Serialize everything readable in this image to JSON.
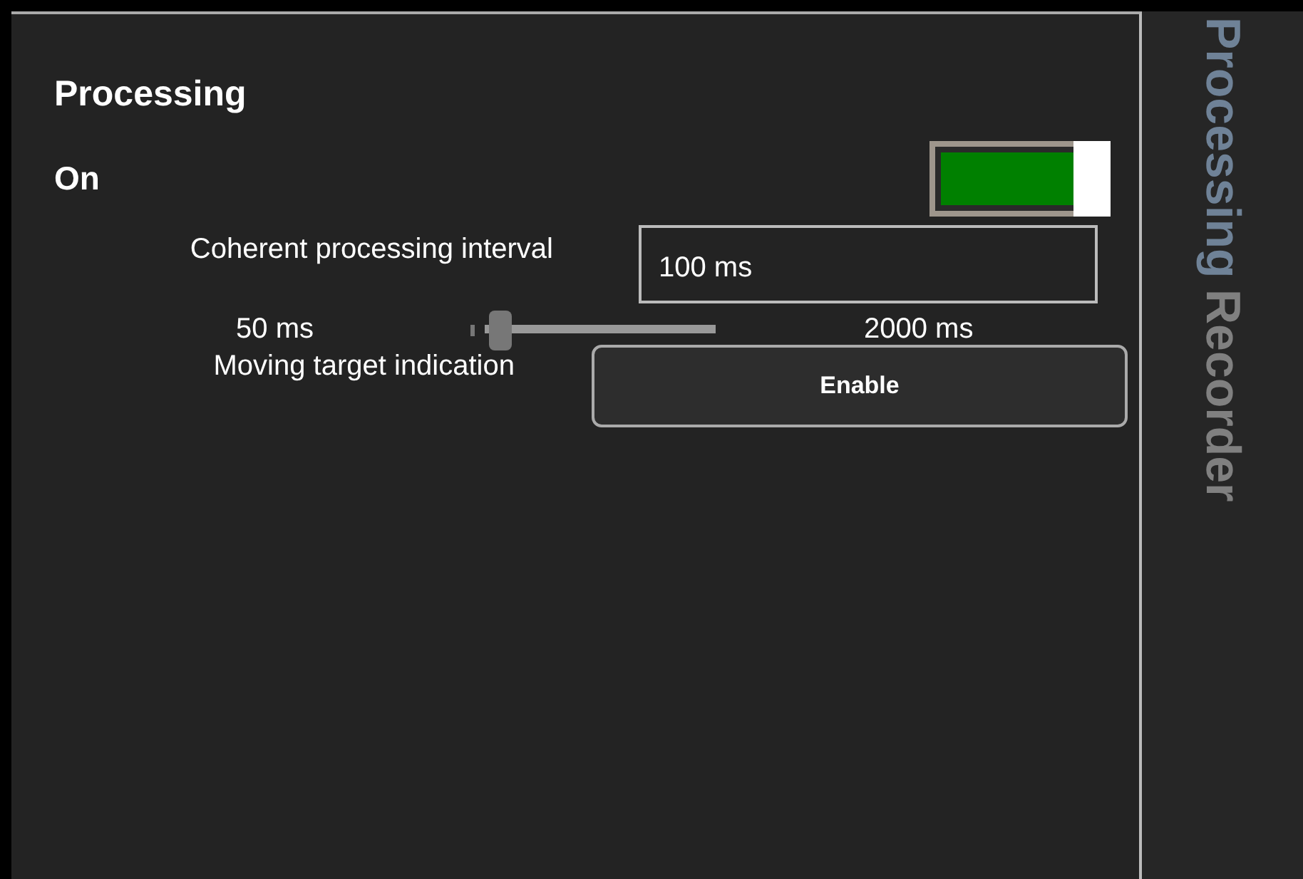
{
  "panel": {
    "title": "Processing",
    "power": {
      "label": "On",
      "on": true
    },
    "interval": {
      "label": "Coherent processing interval",
      "value": "100 ms",
      "min_label": "50 ms",
      "max_label": "2000 ms",
      "level": 0.03
    },
    "mti": {
      "label": "Moving target indication",
      "button": "Enable"
    }
  },
  "side_tabs": [
    {
      "label": "Processing",
      "selected": true
    },
    {
      "label": "Recorder",
      "selected": false
    }
  ]
}
